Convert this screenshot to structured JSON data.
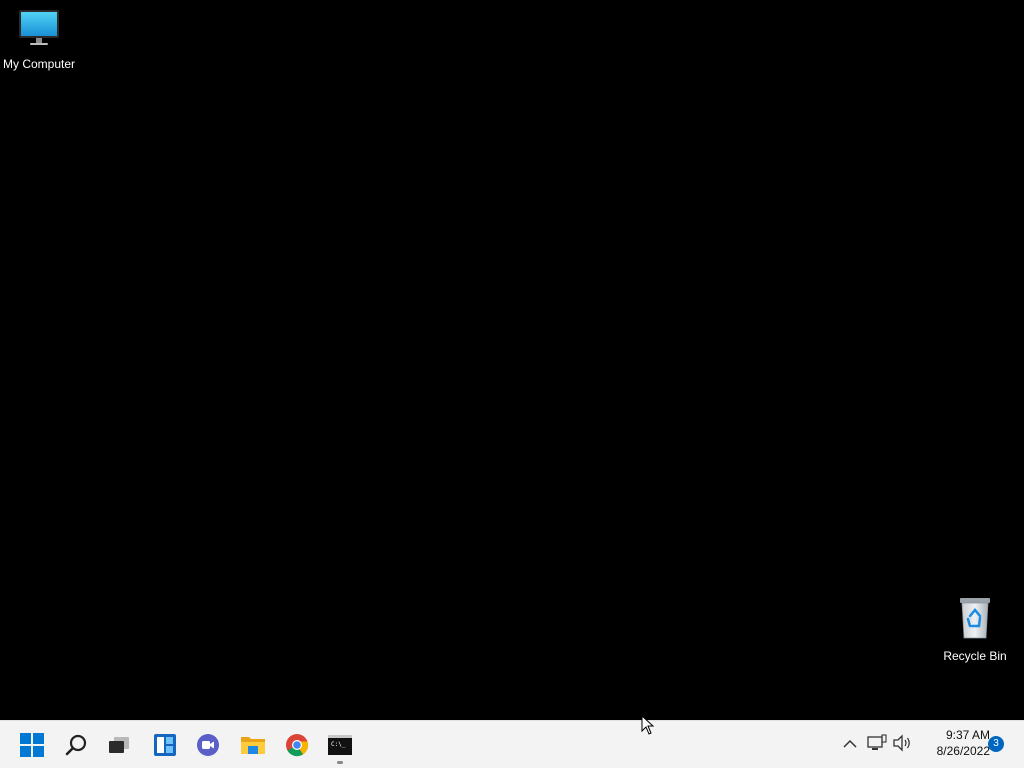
{
  "desktop": {
    "background": "#000000",
    "icons": [
      {
        "label": "My Computer",
        "icon": "monitor-icon"
      },
      {
        "label": "Recycle Bin",
        "icon": "recycle-bin-icon"
      }
    ]
  },
  "taskbar": {
    "background": "#f3f3f3",
    "apps": [
      {
        "name": "Start",
        "icon": "windows-start-icon"
      },
      {
        "name": "Search",
        "icon": "search-icon"
      },
      {
        "name": "Task View",
        "icon": "task-view-icon"
      },
      {
        "name": "Widgets",
        "icon": "widgets-icon"
      },
      {
        "name": "Chat",
        "icon": "chat-icon"
      },
      {
        "name": "File Explorer",
        "icon": "folder-icon"
      },
      {
        "name": "Google Chrome",
        "icon": "chrome-icon"
      },
      {
        "name": "Command Prompt",
        "icon": "terminal-icon",
        "running": true
      }
    ],
    "tray": {
      "icons": [
        "chevron-up-icon",
        "network-icon",
        "speaker-icon"
      ],
      "time": "9:37 AM",
      "date": "8/26/2022",
      "notification_count": "3"
    }
  },
  "colors": {
    "accent": "#0067c0",
    "windows_blue": "#0078d4"
  }
}
